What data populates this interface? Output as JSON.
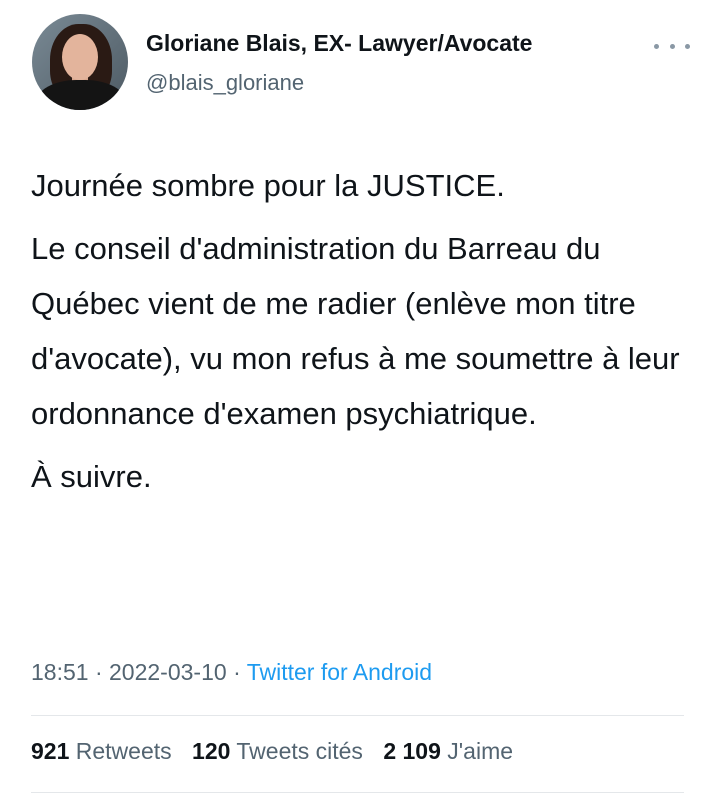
{
  "author": {
    "display_name": "Gloriane Blais, EX- Lawyer/Avocate",
    "handle": "@blais_gloriane"
  },
  "tweet": {
    "paragraphs": [
      "Journée sombre pour la JUSTICE.",
      "Le conseil d'administration du Barreau du Québec vient de me radier (enlève mon titre d'avocate), vu mon refus à me soumettre à leur ordonnance d'examen psychiatrique.",
      "À suivre."
    ]
  },
  "meta": {
    "time": "18:51",
    "separator": "·",
    "date": "2022-03-10",
    "source": "Twitter for Android"
  },
  "stats": {
    "retweets_count": "921",
    "retweets_label": "Retweets",
    "quotes_count": "120",
    "quotes_label": "Tweets cités",
    "likes_count": "2 109",
    "likes_label": "J'aime"
  },
  "colors": {
    "link": "#1d9bf0",
    "muted": "#536471",
    "text": "#0f1419"
  }
}
